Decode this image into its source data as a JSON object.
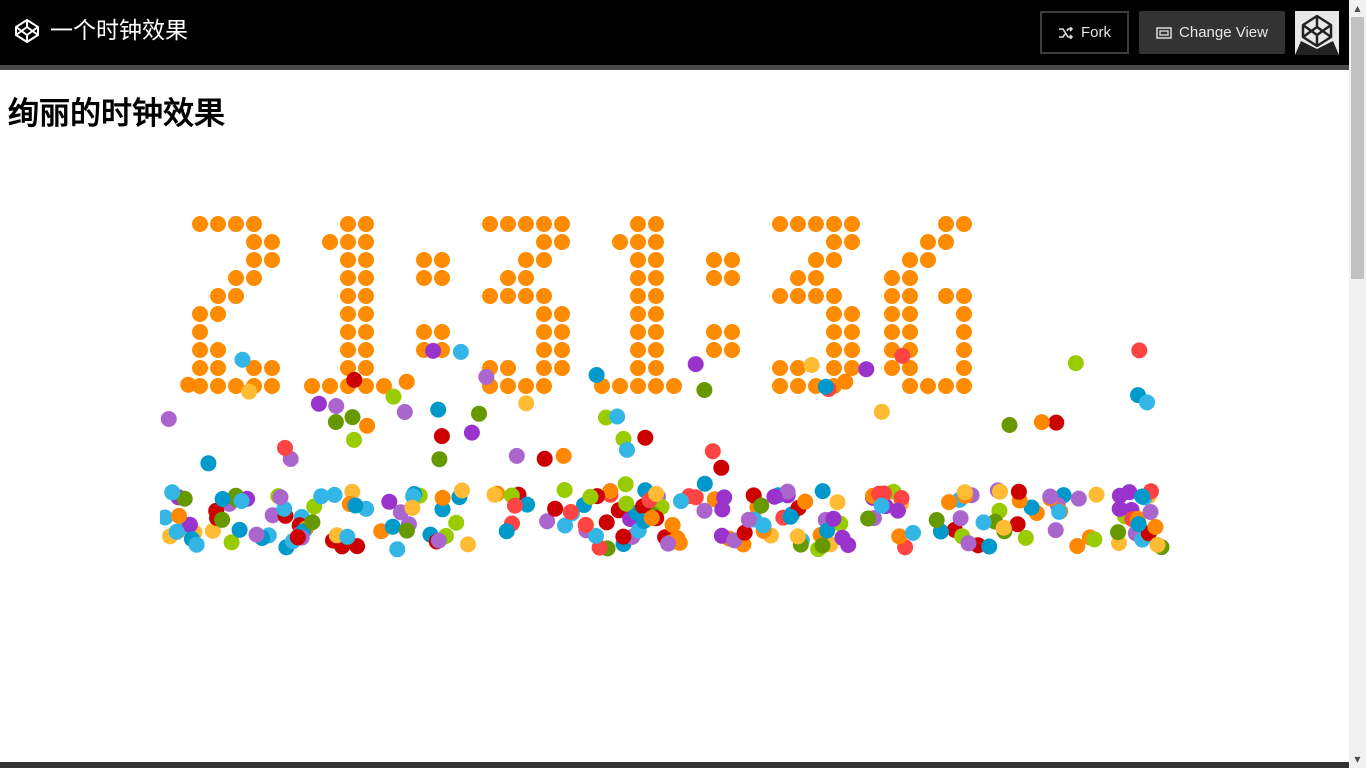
{
  "header": {
    "title": "一个时钟效果",
    "fork_label": "Fork",
    "change_view_label": "Change View",
    "logo_icon": "codepen-logo-icon",
    "fork_icon": "fork-icon",
    "view_icon": "change-view-icon"
  },
  "page": {
    "heading": "绚丽的时钟效果"
  },
  "clock": {
    "time": "21:31:36",
    "digit_color": "#ff8c00",
    "ball_colors": [
      "#33b5e5",
      "#0099cc",
      "#aa66cc",
      "#9933cc",
      "#99cc00",
      "#669900",
      "#ffbb33",
      "#ff8800",
      "#ff4444",
      "#cc0000"
    ]
  },
  "colors": {
    "header_bg": "#000000",
    "button_bg": "#333333",
    "page_bg": "#ffffff"
  }
}
